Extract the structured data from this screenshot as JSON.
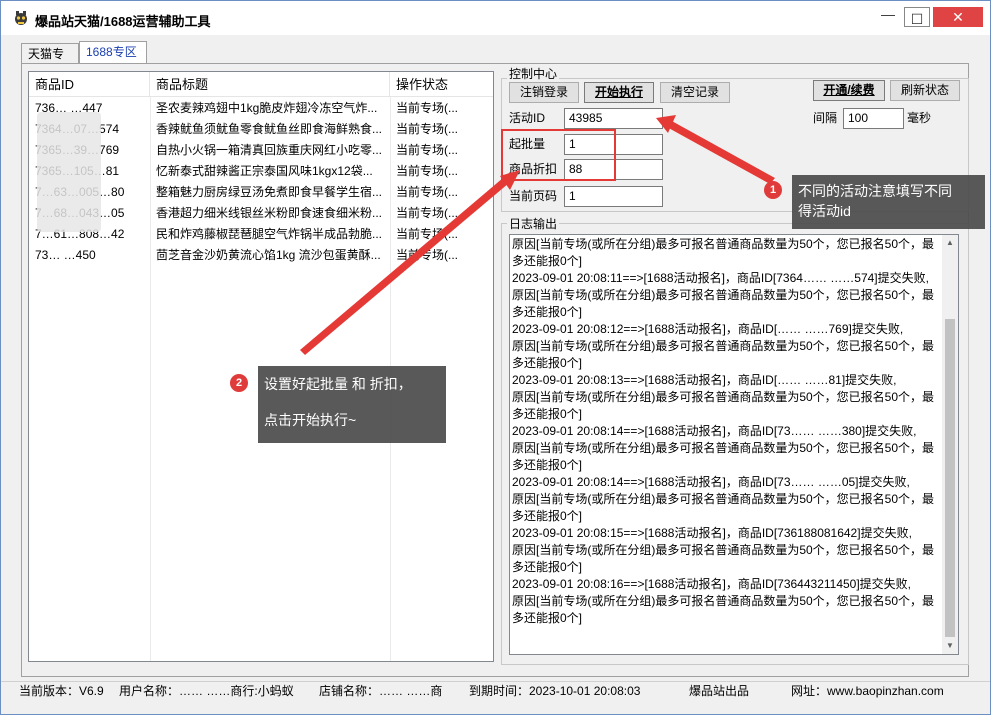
{
  "app": {
    "title": "爆品站天猫/1688运营辅助工具"
  },
  "window_controls": {
    "min": "—",
    "max": "☐",
    "close": "✕"
  },
  "tabs": [
    {
      "label": "天猫专区"
    },
    {
      "label": "1688专区"
    }
  ],
  "table": {
    "columns": [
      "商品ID",
      "商品标题",
      "操作状态"
    ],
    "rows": [
      {
        "id": "736… …447",
        "title": "圣农麦辣鸡翅中1kg脆皮炸翅冷冻空气炸...",
        "state": "当前专场(..."
      },
      {
        "id": "7364…07…574",
        "title": "香辣鱿鱼须鱿鱼零食鱿鱼丝即食海鲜熟食...",
        "state": "当前专场(..."
      },
      {
        "id": "7365…39…769",
        "title": "自热小火锅一箱清真回族重庆网红小吃零...",
        "state": "当前专场(..."
      },
      {
        "id": "7365…105…81",
        "title": "忆新泰式甜辣酱正宗泰国风味1kgx12袋...",
        "state": "当前专场(..."
      },
      {
        "id": "7…63…005…80",
        "title": "整箱魅力厨房绿豆汤免煮即食早餐学生宿...",
        "state": "当前专场(..."
      },
      {
        "id": "7…68…043…05",
        "title": "香港超力细米线银丝米粉即食速食细米粉...",
        "state": "当前专场(..."
      },
      {
        "id": "7…61…808…42",
        "title": "民和炸鸡藤椒琵琶腿空气炸锅半成品勃脆...",
        "state": "当前专场(..."
      },
      {
        "id": "73… …450",
        "title": "茴芝音金沙奶黄流心馅1kg 流沙包蛋黄酥...",
        "state": "当前专场(..."
      }
    ]
  },
  "control": {
    "group_label": "控制中心",
    "logout_label": "注销登录",
    "start_label": "开始执行",
    "clear_label": "清空记录",
    "activate_label": "开通/续费",
    "refresh_label": "刷新状态",
    "activity_id_label": "活动ID",
    "activity_id_value": "43985",
    "interval_label": "间隔",
    "interval_value": "100",
    "interval_unit": "毫秒",
    "min_qty_label": "起批量",
    "min_qty_value": "1",
    "discount_label": "商品折扣",
    "discount_value": "88",
    "page_label": "当前页码",
    "page_value": "1"
  },
  "log": {
    "group_label": "日志输出",
    "lines": [
      "原因[当前专场(或所在分组)最多可报名普通商品数量为50个，您已报名50个，最",
      "多还能报0个]",
      "2023-09-01 20:08:11==>[1688活动报名]，商品ID[7364…… ……574]提交失败,",
      "原因[当前专场(或所在分组)最多可报名普通商品数量为50个，您已报名50个，最",
      "多还能报0个]",
      "2023-09-01 20:08:12==>[1688活动报名]，商品ID[…… ……769]提交失败,",
      "原因[当前专场(或所在分组)最多可报名普通商品数量为50个，您已报名50个，最",
      "多还能报0个]",
      "2023-09-01 20:08:13==>[1688活动报名]，商品ID[…… ……81]提交失败,",
      "原因[当前专场(或所在分组)最多可报名普通商品数量为50个，您已报名50个，最",
      "多还能报0个]",
      "2023-09-01 20:08:14==>[1688活动报名]，商品ID[73…… ……380]提交失败,",
      "原因[当前专场(或所在分组)最多可报名普通商品数量为50个，您已报名50个，最",
      "多还能报0个]",
      "2023-09-01 20:08:14==>[1688活动报名]，商品ID[73…… ……05]提交失败,",
      "原因[当前专场(或所在分组)最多可报名普通商品数量为50个，您已报名50个，最",
      "多还能报0个]",
      "2023-09-01 20:08:15==>[1688活动报名]，商品ID[736188081642]提交失败,",
      "原因[当前专场(或所在分组)最多可报名普通商品数量为50个，您已报名50个，最",
      "多还能报0个]",
      "2023-09-01 20:08:16==>[1688活动报名]，商品ID[736443211450]提交失败,",
      "原因[当前专场(或所在分组)最多可报名普通商品数量为50个，您已报名50个，最",
      "多还能报0个]"
    ]
  },
  "status": {
    "version": "当前版本：V6.9",
    "user": "用户名称：…… ……商行:小蚂蚁",
    "shop": "店铺名称：…… ……商",
    "expire": "到期时间：2023-10-01 20:08:03",
    "brand": "爆品站出品",
    "site": "网址：www.baopinzhan.com"
  },
  "annotations": {
    "badge1": "1",
    "note1_line1": "不同的活动注意填写不同",
    "note1_line2": "得活动id",
    "badge2": "2",
    "note2_line1": "设置好起批量 和 折扣，",
    "note2_line2": "点击开始执行~"
  },
  "colors": {
    "accent": "#1a3fb0",
    "annotation_red": "#e53935",
    "callout_bg": "#4b4b4b"
  }
}
